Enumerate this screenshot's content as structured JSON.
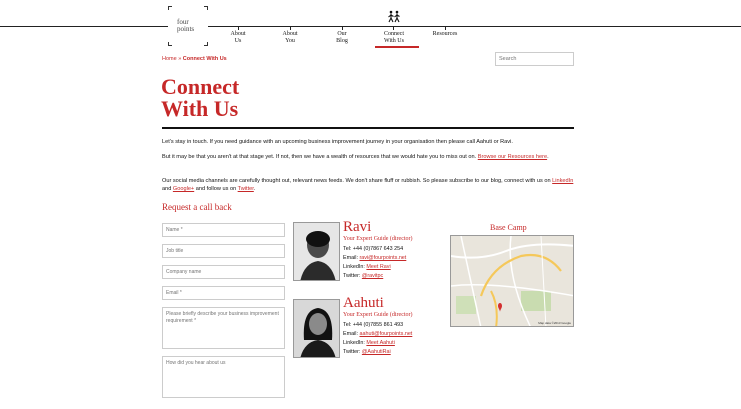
{
  "logo": {
    "text_line1": "four",
    "text_line2": "points"
  },
  "nav": [
    {
      "l1": "About",
      "l2": "Us"
    },
    {
      "l1": "About",
      "l2": "You"
    },
    {
      "l1": "Our",
      "l2": "Blog"
    },
    {
      "l1": "Connect",
      "l2": "With Us"
    },
    {
      "l1": "Resources",
      "l2": ""
    }
  ],
  "breadcrumb": {
    "home": "Home",
    "sep": "»",
    "current": "Connect With Us"
  },
  "search": {
    "placeholder": "Search"
  },
  "page": {
    "title_line1": "Connect",
    "title_line2": "With Us"
  },
  "intro": {
    "p1": "Let's stay in touch.  If you need guidance with an upcoming business improvement journey in your organisation then please call Aahuti or Ravi.",
    "p2_text": "But it may be that you aren't at that stage yet. If not, then we have a wealth of resources that we would hate you to miss out on.  ",
    "p2_link": "Browse our Resources here",
    "p2_end": ".",
    "p3_text": "Our social media channels are carefully thought out, relevant news feeds. We don't share fluff or rubbish. So please subscribe to our blog, connect with us on ",
    "p3_link1": "LinkedIn",
    "p3_and": " and ",
    "p3_link2": "Google+",
    "p3_follow": " and follow us on ",
    "p3_link3": "Twitter",
    "p3_end": "."
  },
  "form": {
    "heading": "Request a call back",
    "name_placeholder": "Name *",
    "job_placeholder": "Job title",
    "company_placeholder": "Company name",
    "email_placeholder": "Email *",
    "requirement_placeholder": "Please briefly describe your business improvement requirement *",
    "hear_placeholder": "How did you hear about us"
  },
  "contacts": [
    {
      "name": "Ravi",
      "role": "Your Expert Guide  (director)",
      "tel": "Tel: +44 (0)7867 643 254",
      "email_label": "Email: ",
      "email": "ravi@fourpoints.net",
      "linkedin_label": "LinkedIn: ",
      "linkedin": "Meet Ravi",
      "twitter_label": "Twitter: ",
      "twitter": "@ravitpc"
    },
    {
      "name": "Aahuti",
      "role": "Your Expert Guide  (director)",
      "tel": "Tel: +44 (0)7855 861 493",
      "email_label": "Email: ",
      "email": "aahuti@fourpoints.net",
      "linkedin_label": "LinkedIn: ",
      "linkedin": "Meet Aahuti",
      "twitter_label": "Twitter: ",
      "twitter": "@AahutiRai"
    }
  ],
  "basecamp": {
    "heading": "Base Camp",
    "map_credit": "Map data ©2013 Google"
  }
}
